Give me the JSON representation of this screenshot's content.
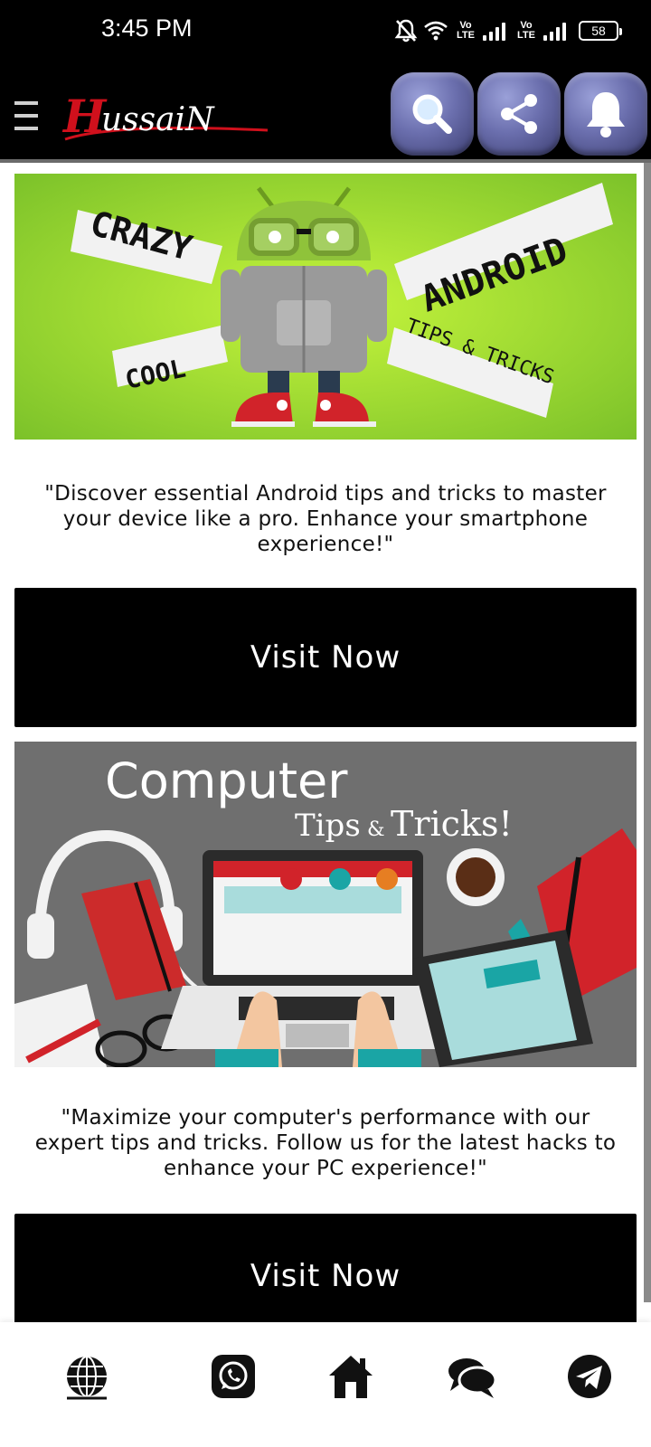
{
  "status_bar": {
    "time": "3:45 PM",
    "network_label": "Vo LTE",
    "battery": "58",
    "icons": [
      "bell-off-icon",
      "wifi-icon",
      "signal-icon",
      "battery-icon"
    ]
  },
  "header": {
    "logo_text": "Hussain",
    "buttons": [
      "search-icon",
      "share-icon",
      "bell-icon"
    ],
    "accent": "#6b6fae"
  },
  "cards": [
    {
      "image": {
        "words": [
          "CRAZY",
          "ANDROID",
          "COOL",
          "TIPS & TRICKS"
        ],
        "bg_color": "#8fd334"
      },
      "description": "\"Discover essential Android tips and tricks to master your device like a pro. Enhance your smartphone experience!\"",
      "button_label": "Visit Now"
    },
    {
      "image": {
        "title": "Computer",
        "subtitle_a": "Tips",
        "subtitle_amp": "&",
        "subtitle_b": "Tricks!",
        "bg_color": "#707070"
      },
      "description": "\"Maximize your computer's performance with our expert tips and tricks. Follow us for the latest hacks to enhance your PC experience!\"",
      "button_label": "Visit Now"
    }
  ],
  "bottom_nav": {
    "items": [
      "globe-icon",
      "whatsapp-icon",
      "home-icon",
      "chat-icon",
      "telegram-icon"
    ]
  }
}
